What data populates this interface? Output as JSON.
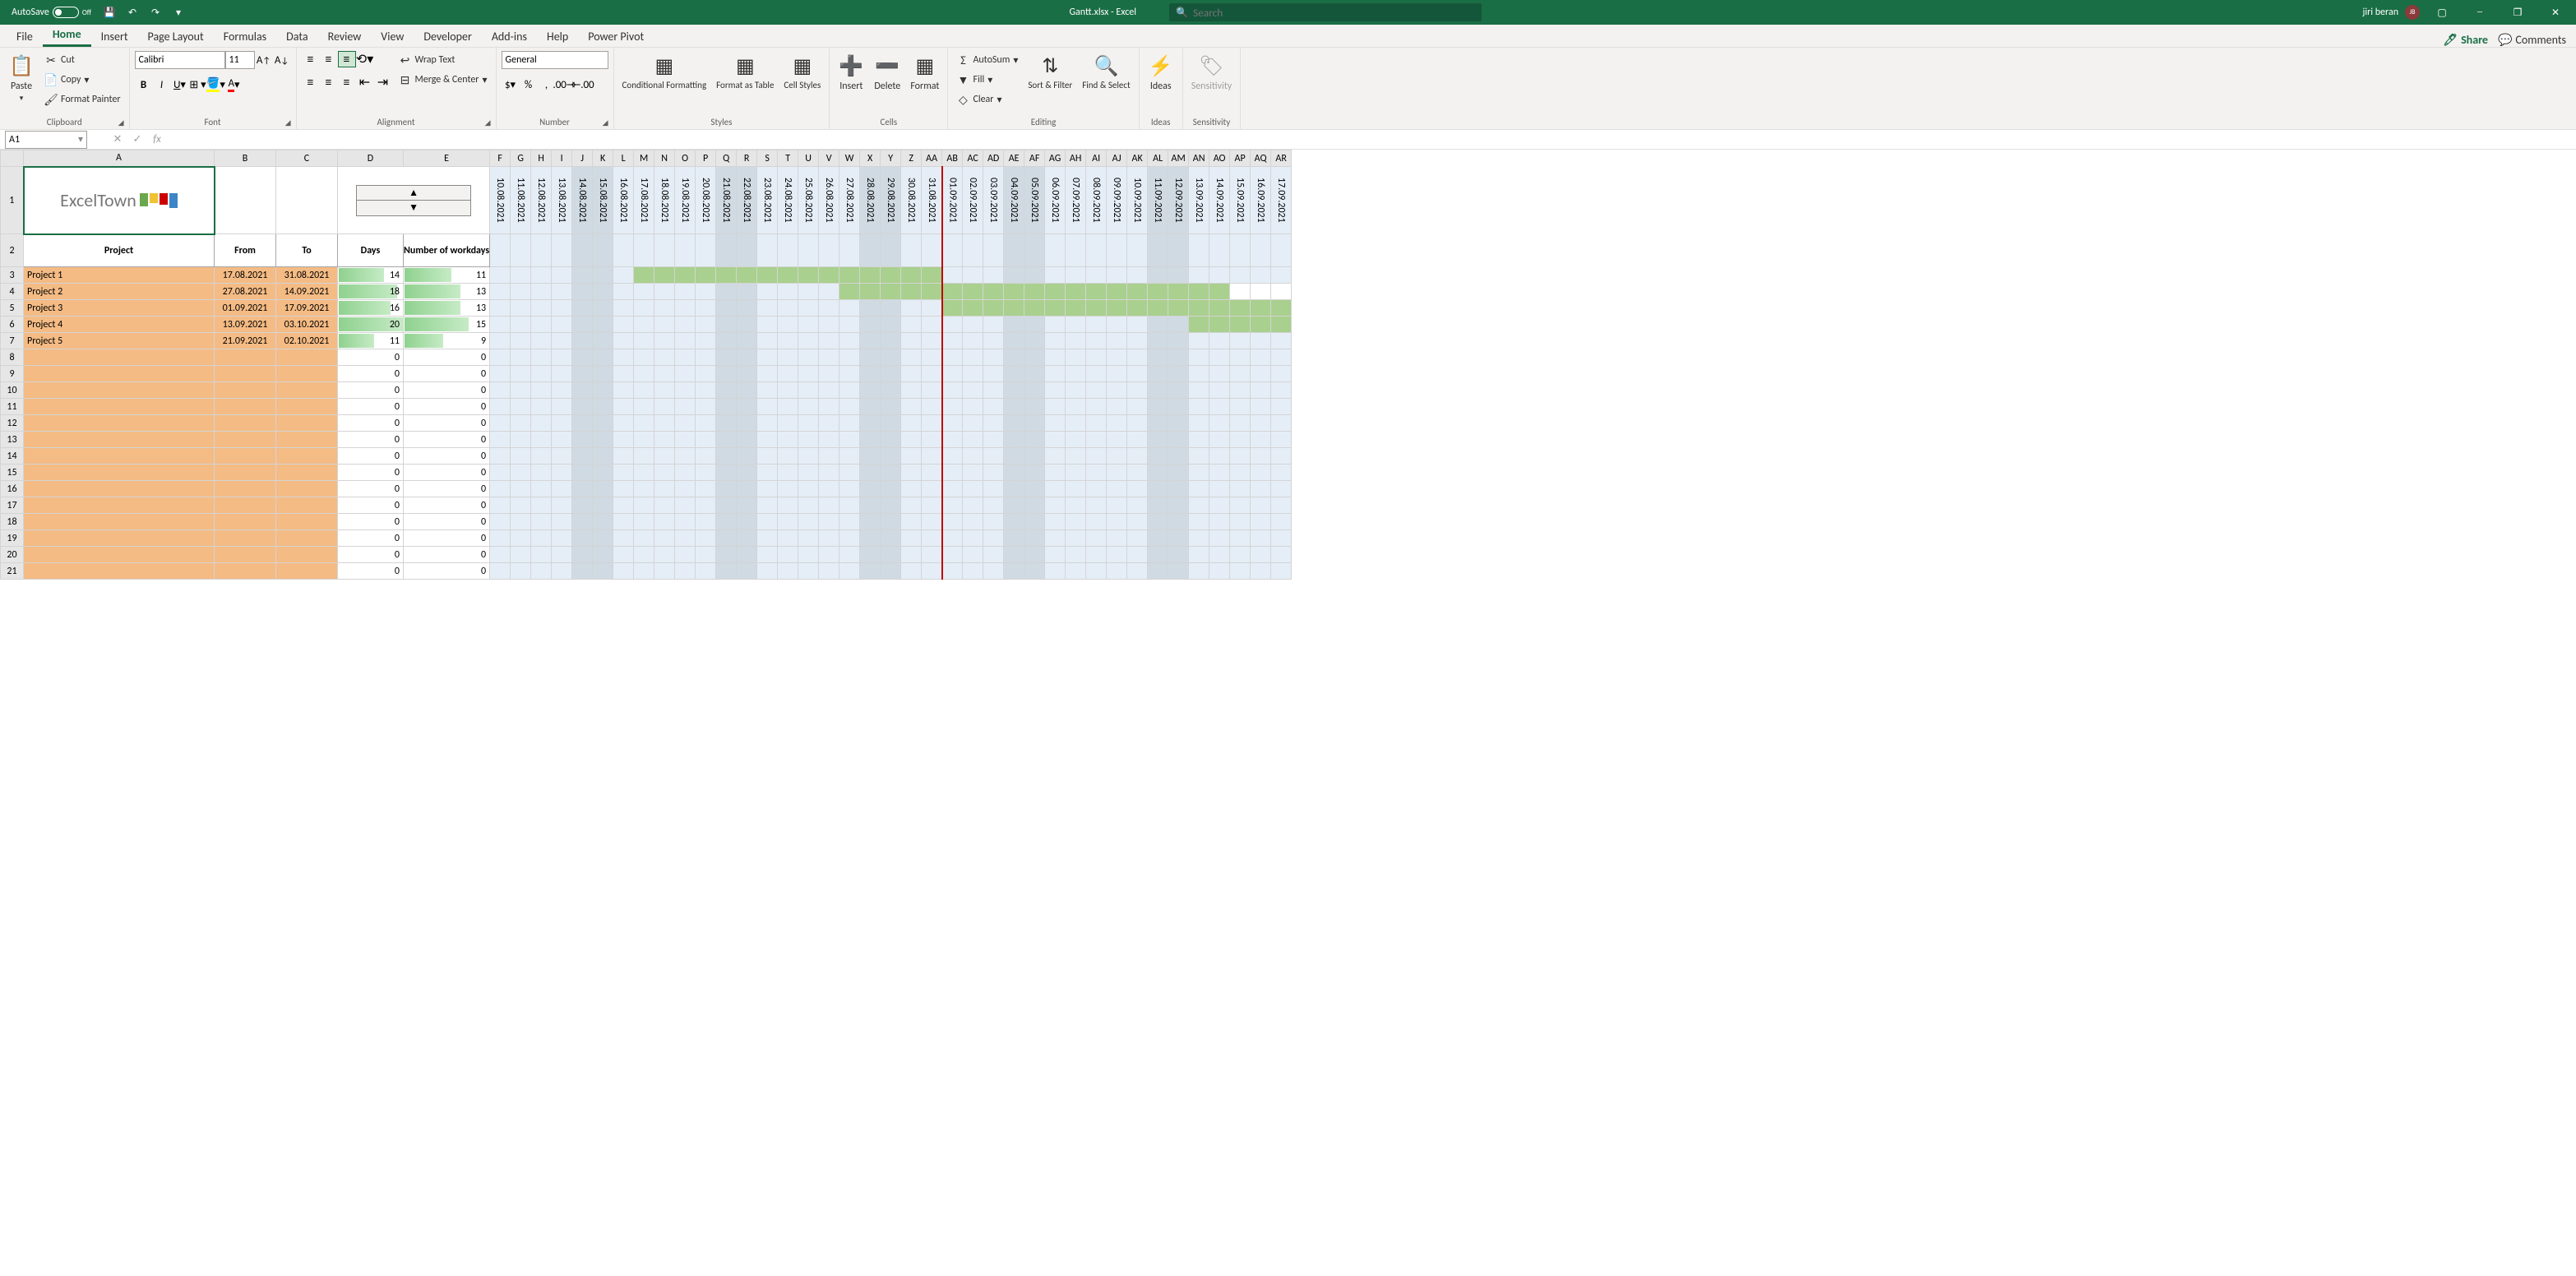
{
  "titlebar": {
    "autosave": "AutoSave",
    "autosave_state": "Off",
    "doc_title": "Gantt.xlsx  -  Excel",
    "search_placeholder": "Search",
    "username": "jiri beran",
    "avatar_initials": "JB"
  },
  "tabs": {
    "file": "File",
    "home": "Home",
    "insert": "Insert",
    "page_layout": "Page Layout",
    "formulas": "Formulas",
    "data": "Data",
    "review": "Review",
    "view": "View",
    "developer": "Developer",
    "addins": "Add-ins",
    "help": "Help",
    "power_pivot": "Power Pivot",
    "share": "Share",
    "comments": "Comments"
  },
  "ribbon": {
    "clipboard": {
      "label": "Clipboard",
      "paste": "Paste",
      "cut": "Cut",
      "copy": "Copy",
      "format_painter": "Format Painter"
    },
    "font": {
      "label": "Font",
      "name": "Calibri",
      "size": "11"
    },
    "alignment": {
      "label": "Alignment",
      "wrap": "Wrap Text",
      "merge": "Merge & Center"
    },
    "number": {
      "label": "Number",
      "format": "General"
    },
    "styles": {
      "label": "Styles",
      "cond": "Conditional Formatting",
      "table": "Format as Table",
      "cell": "Cell Styles"
    },
    "cells": {
      "label": "Cells",
      "insert": "Insert",
      "delete": "Delete",
      "format": "Format"
    },
    "editing": {
      "label": "Editing",
      "autosum": "AutoSum",
      "fill": "Fill",
      "clear": "Clear",
      "sort": "Sort & Filter",
      "find": "Find & Select"
    },
    "ideas": {
      "label": "Ideas",
      "ideas": "Ideas"
    },
    "sensitivity": {
      "label": "Sensitivity",
      "sensitivity": "Sensitivity"
    }
  },
  "formula_bar": {
    "name_box": "A1",
    "formula": ""
  },
  "columns": [
    "A",
    "B",
    "C",
    "D",
    "E",
    "F",
    "G",
    "H",
    "I",
    "J",
    "K",
    "L",
    "M",
    "N",
    "O",
    "P",
    "Q",
    "R",
    "S",
    "T",
    "U",
    "V",
    "W",
    "X",
    "Y",
    "Z",
    "AA",
    "AB",
    "AC",
    "AD",
    "AE",
    "AF",
    "AG",
    "AH",
    "AI",
    "AJ",
    "AK",
    "AL",
    "AM",
    "AN",
    "AO",
    "AP",
    "AQ",
    "AR"
  ],
  "dates": [
    "10.08.2021",
    "11.08.2021",
    "12.08.2021",
    "13.08.2021",
    "14.08.2021",
    "15.08.2021",
    "16.08.2021",
    "17.08.2021",
    "18.08.2021",
    "19.08.2021",
    "20.08.2021",
    "21.08.2021",
    "22.08.2021",
    "23.08.2021",
    "24.08.2021",
    "25.08.2021",
    "26.08.2021",
    "27.08.2021",
    "28.08.2021",
    "29.08.2021",
    "30.08.2021",
    "31.08.2021",
    "01.09.2021",
    "02.09.2021",
    "03.09.2021",
    "04.09.2021",
    "05.09.2021",
    "06.09.2021",
    "07.09.2021",
    "08.09.2021",
    "09.09.2021",
    "10.09.2021",
    "11.09.2021",
    "12.09.2021",
    "13.09.2021",
    "14.09.2021",
    "15.09.2021",
    "16.09.2021",
    "17.09.2021"
  ],
  "weekend_indices": [
    4,
    5,
    11,
    12,
    18,
    19,
    25,
    26,
    32,
    33
  ],
  "today_index": 22,
  "headers": {
    "project": "Project",
    "from": "From",
    "to": "To",
    "days": "Days",
    "workdays": "Number of workdays"
  },
  "logo_text": "ExcelTown",
  "projects": [
    {
      "row": 3,
      "name": "Project 1",
      "from": "17.08.2021",
      "to": "31.08.2021",
      "days": 14,
      "workdays": 11,
      "start_idx": 7,
      "end_idx": 21
    },
    {
      "row": 4,
      "name": "Project 2",
      "from": "27.08.2021",
      "to": "14.09.2021",
      "days": 18,
      "workdays": 13,
      "start_idx": 17,
      "end_idx": 35
    },
    {
      "row": 5,
      "name": "Project 3",
      "from": "01.09.2021",
      "to": "17.09.2021",
      "days": 16,
      "workdays": 13,
      "start_idx": 22,
      "end_idx": 38
    },
    {
      "row": 6,
      "name": "Project 4",
      "from": "13.09.2021",
      "to": "03.10.2021",
      "days": 20,
      "workdays": 15,
      "start_idx": 34,
      "end_idx": 99
    },
    {
      "row": 7,
      "name": "Project 5",
      "from": "21.09.2021",
      "to": "02.10.2021",
      "days": 11,
      "workdays": 9,
      "start_idx": 99,
      "end_idx": 99
    }
  ],
  "empty_rows": [
    8,
    9,
    10,
    11,
    12,
    13,
    14,
    15,
    16,
    17,
    18,
    19,
    20,
    21
  ],
  "max_days": 20
}
